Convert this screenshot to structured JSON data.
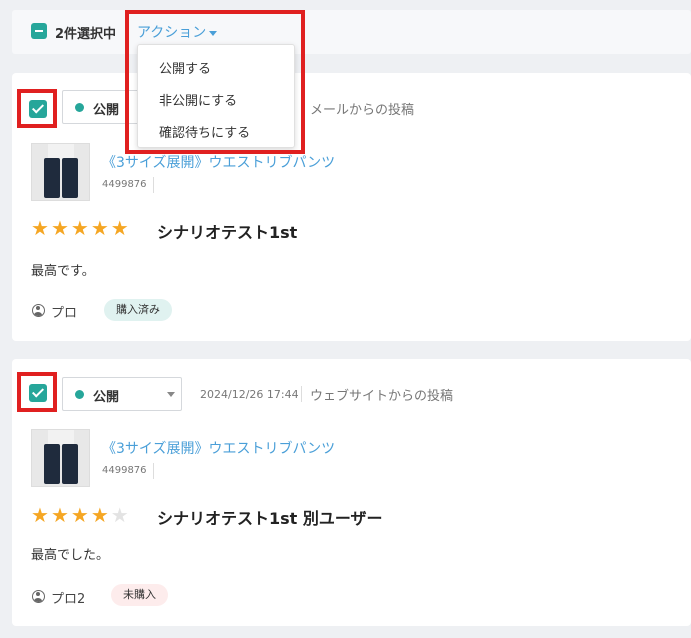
{
  "bulk_bar": {
    "selected_count": "2件選択中",
    "action_label": "アクション"
  },
  "action_menu": {
    "items": [
      "公開する",
      "非公開にする",
      "確認待ちにする"
    ]
  },
  "reviews": [
    {
      "status": "公開",
      "date": "",
      "source": "メールからの投稿",
      "product_name": "《3サイズ展開》ウエストリブパンツ",
      "product_id": "4499876",
      "rating": 5,
      "title": "シナリオテスト1st",
      "body": "最高です。",
      "user": "プロ",
      "purchase_badge": "購入済み"
    },
    {
      "status": "公開",
      "date": "2024/12/26 17:44",
      "source": "ウェブサイトからの投稿",
      "product_name": "《3サイズ展開》ウエストリブパンツ",
      "product_id": "4499876",
      "rating": 4,
      "title": "シナリオテスト1st 別ユーザー",
      "body": "最高でした。",
      "user": "プロ2",
      "purchase_badge": "未購入"
    }
  ],
  "colors": {
    "accent": "#26a69a",
    "link": "#4a9fd8",
    "star": "#f5a623",
    "highlight": "#e02020"
  }
}
